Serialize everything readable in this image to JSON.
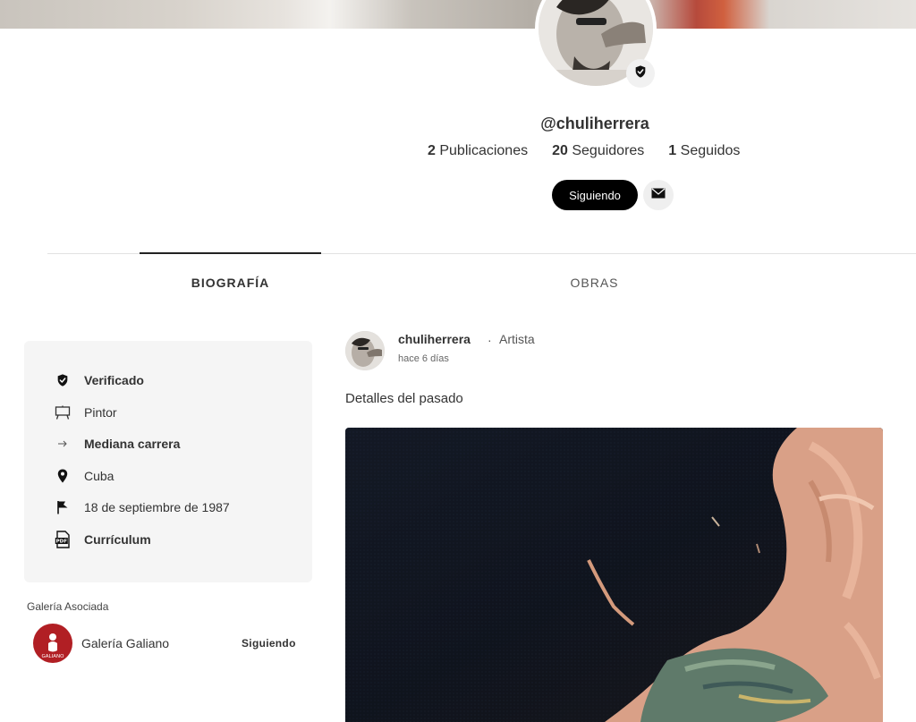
{
  "profile": {
    "username": "@chuliherrera",
    "stats": [
      {
        "count": "2",
        "label": "Publicaciones"
      },
      {
        "count": "20",
        "label": "Seguidores"
      },
      {
        "count": "1",
        "label": "Seguidos"
      }
    ],
    "follow_label": "Siguiendo"
  },
  "tabs": [
    {
      "label": "BIOGRAFÍA",
      "active": true
    },
    {
      "label": "OBRAS",
      "active": false
    }
  ],
  "bio": {
    "items": [
      {
        "icon": "shield-check-icon",
        "text": "Verificado",
        "bold": true
      },
      {
        "icon": "easel-icon",
        "text": "Pintor",
        "bold": false
      },
      {
        "icon": "arrow-right-icon",
        "text": "Mediana carrera",
        "bold": true
      },
      {
        "icon": "location-pin-icon",
        "text": "Cuba",
        "bold": false
      },
      {
        "icon": "flag-icon",
        "text": "18 de septiembre de 1987",
        "bold": false
      },
      {
        "icon": "pdf-icon",
        "text": "Currículum",
        "bold": true
      }
    ]
  },
  "gallery": {
    "title": "Galería Asociada",
    "name": "Galería Galiano",
    "logo_text": "GALIANO",
    "follow_label": "Siguiendo",
    "brand_color": "#b11f24"
  },
  "post": {
    "user": "chuliherrera",
    "separator": "·",
    "role": "Artista",
    "time": "hace 6 días",
    "text": "Detalles del pasado"
  }
}
